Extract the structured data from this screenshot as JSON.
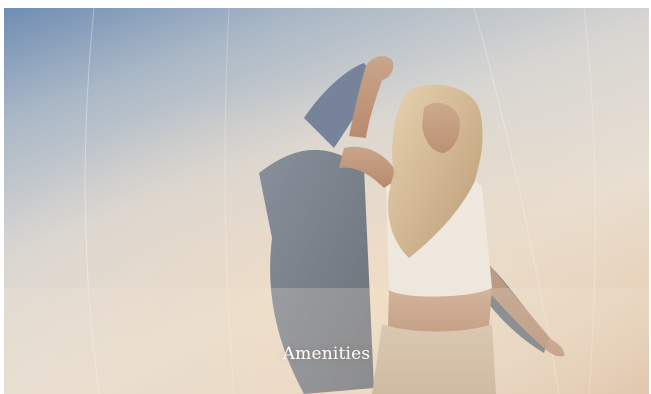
{
  "hero": {
    "caption": "Amenities",
    "image_subject": "woman-dancing-at-sunset",
    "colors": {
      "sky_top": "#6f8db3",
      "haze": "#e9dfd2",
      "warm_glow": "#d9b89a",
      "caption_text": "#ffffff"
    }
  }
}
